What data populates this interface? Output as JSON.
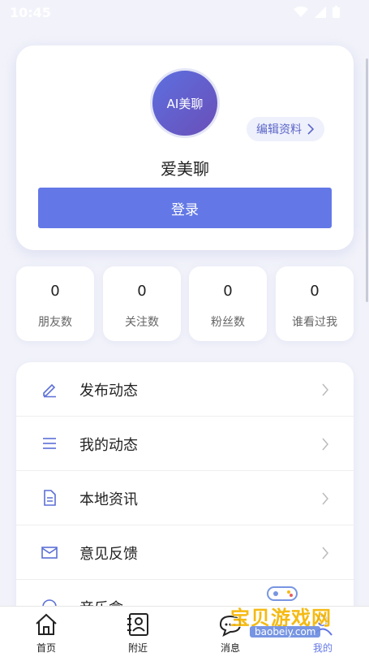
{
  "status_bar": {
    "time": "10:45"
  },
  "profile": {
    "avatar_text": "AI美聊",
    "edit_label": "编辑资料",
    "name": "爱美聊",
    "login_label": "登录"
  },
  "stats": [
    {
      "value": "0",
      "label": "朋友数"
    },
    {
      "value": "0",
      "label": "关注数"
    },
    {
      "value": "0",
      "label": "粉丝数"
    },
    {
      "value": "0",
      "label": "谁看过我"
    }
  ],
  "menu": [
    {
      "label": "发布动态",
      "icon": "edit-icon"
    },
    {
      "label": "我的动态",
      "icon": "list-icon"
    },
    {
      "label": "本地资讯",
      "icon": "document-icon"
    },
    {
      "label": "意见反馈",
      "icon": "mail-icon"
    },
    {
      "label": "音乐盒",
      "icon": "circle-icon"
    }
  ],
  "tabs": [
    {
      "label": "首页",
      "icon": "home-icon"
    },
    {
      "label": "附近",
      "icon": "contacts-icon"
    },
    {
      "label": "消息",
      "icon": "chat-icon"
    },
    {
      "label": "我的",
      "icon": "profile-icon"
    }
  ],
  "watermark": {
    "text": "宝贝游戏网",
    "url": "baobeiy.com"
  },
  "colors": {
    "accent": "#6378e6",
    "background": "#f2f3fa",
    "icon_blue": "#5b6fd6"
  }
}
